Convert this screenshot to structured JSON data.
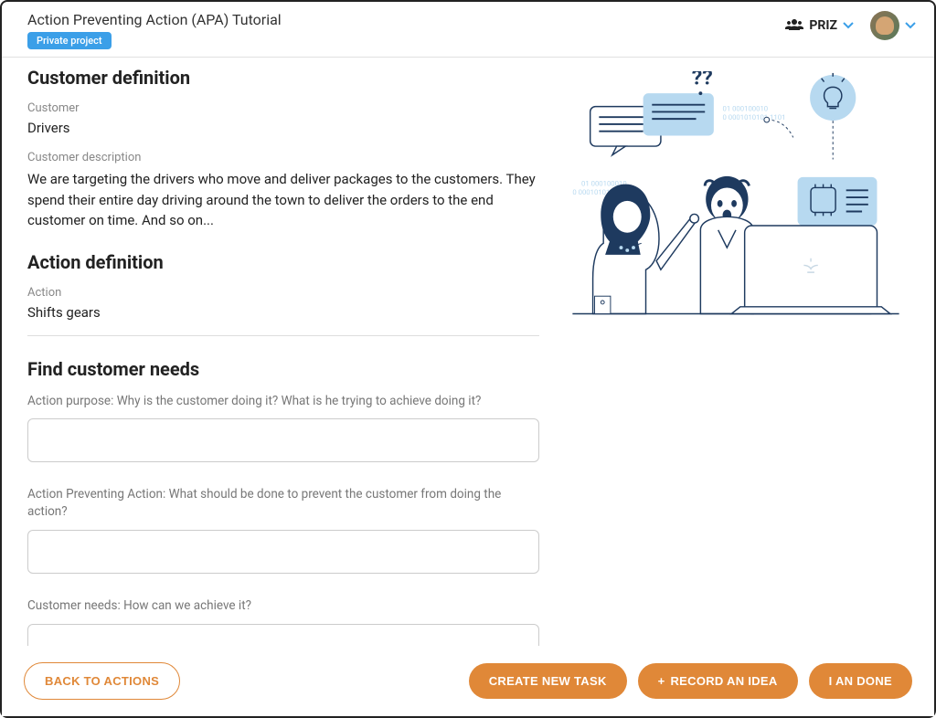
{
  "header": {
    "title": "Action Preventing Action (APA) Tutorial",
    "badge": "Private project",
    "team": "PRIZ"
  },
  "customer_definition": {
    "heading": "Customer definition",
    "customer_label": "Customer",
    "customer_value": "Drivers",
    "description_label": "Customer description",
    "description_value": "We are targeting the drivers who move and deliver packages to the customers. They spend their entire day driving around the town to deliver the orders to the end customer on time. And so on..."
  },
  "action_definition": {
    "heading": "Action definition",
    "action_label": "Action",
    "action_value": "Shifts gears"
  },
  "find_needs": {
    "heading": "Find customer needs",
    "action_purpose_label": "Action purpose: Why is the customer doing it? What is he trying to achieve doing it?",
    "action_purpose_value": "",
    "apa_label": "Action Preventing Action: What should be done to prevent the customer from doing the action?",
    "apa_value": "",
    "customer_needs_label": "Customer needs: How can we achieve it?",
    "customer_needs_value": ""
  },
  "footer": {
    "back": "BACK TO ACTIONS",
    "create_task": "CREATE NEW TASK",
    "record_idea": "RECORD AN IDEA",
    "done": "I AN DONE"
  }
}
